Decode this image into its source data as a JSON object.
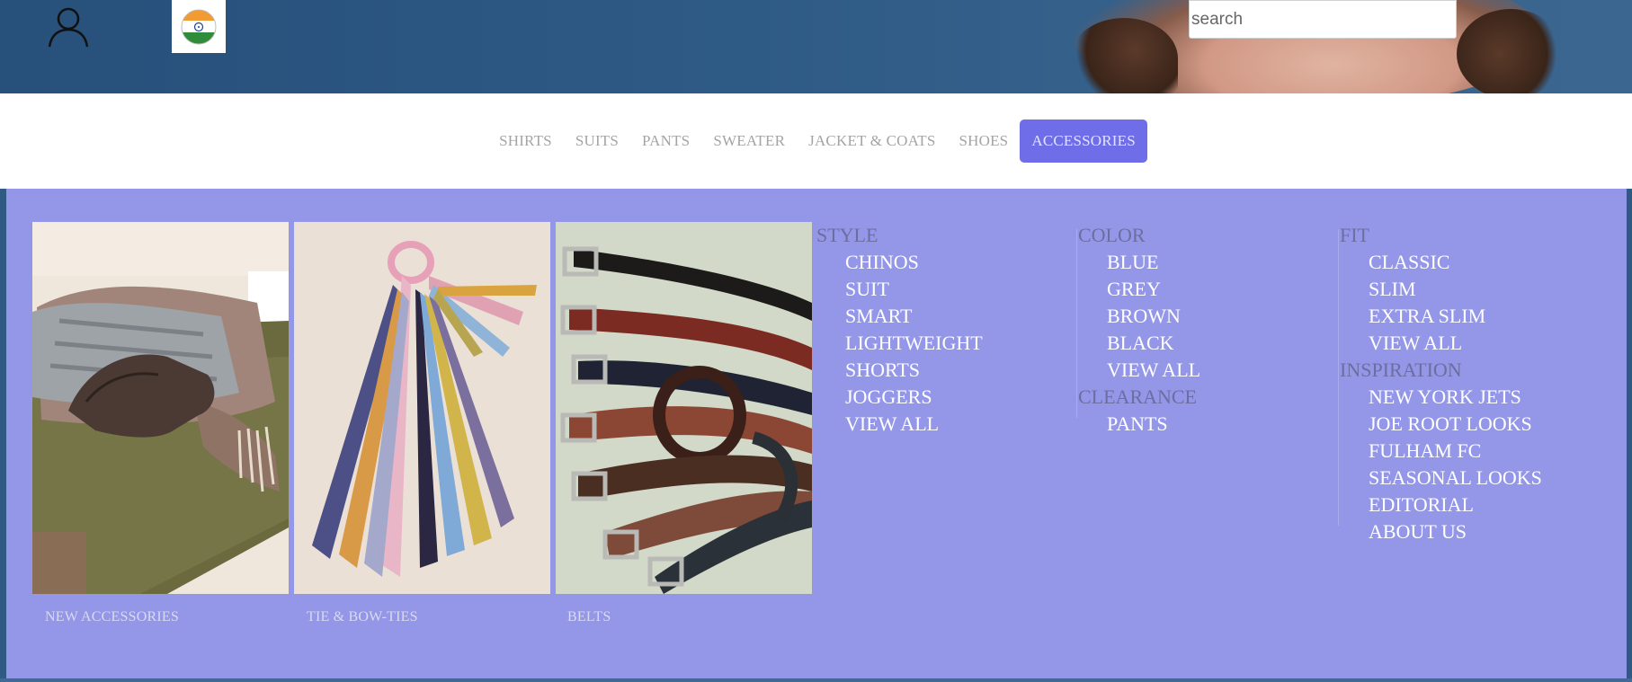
{
  "header": {
    "user_icon": "user-icon",
    "flag_icon": "india-flag-icon",
    "search": {
      "placeholder": "search",
      "value": ""
    }
  },
  "nav": {
    "items": [
      {
        "label": "SHIRTS",
        "active": false
      },
      {
        "label": "SUITS",
        "active": false
      },
      {
        "label": "PANTS",
        "active": false
      },
      {
        "label": "SWEATER",
        "active": false
      },
      {
        "label": "JACKET & COATS",
        "active": false
      },
      {
        "label": "SHOES",
        "active": false
      },
      {
        "label": "ACCESSORIES",
        "active": true
      }
    ],
    "active_color": "#6f6de8"
  },
  "mega_menu": {
    "background": "#9497e8",
    "tiles": [
      {
        "label": "NEW ACCESSORIES",
        "image": "scarves-gloves-image"
      },
      {
        "label": "TIE & BOW-TIES",
        "image": "ties-image"
      },
      {
        "label": "BELTS",
        "image": "belts-image"
      }
    ],
    "columns": [
      {
        "sections": [
          {
            "heading": "STYLE",
            "links": [
              "CHINOS",
              "SUIT",
              "SMART",
              "LIGHTWEIGHT",
              "SHORTS",
              "JOGGERS",
              "VIEW ALL"
            ]
          }
        ]
      },
      {
        "sections": [
          {
            "heading": "COLOR",
            "links": [
              "BLUE",
              "GREY",
              "BROWN",
              "BLACK",
              "VIEW ALL"
            ]
          },
          {
            "heading": "CLEARANCE",
            "links": [
              "PANTS"
            ]
          }
        ]
      },
      {
        "sections": [
          {
            "heading": "FIT",
            "links": [
              "CLASSIC",
              "SLIM",
              "EXTRA SLIM",
              "VIEW ALL"
            ]
          },
          {
            "heading": "INSPIRATION",
            "links": [
              "NEW YORK JETS",
              "JOE ROOT LOOKS",
              "FULHAM FC",
              "SEASONAL LOOKS",
              "EDITORIAL",
              "ABOUT US"
            ]
          }
        ]
      }
    ]
  }
}
